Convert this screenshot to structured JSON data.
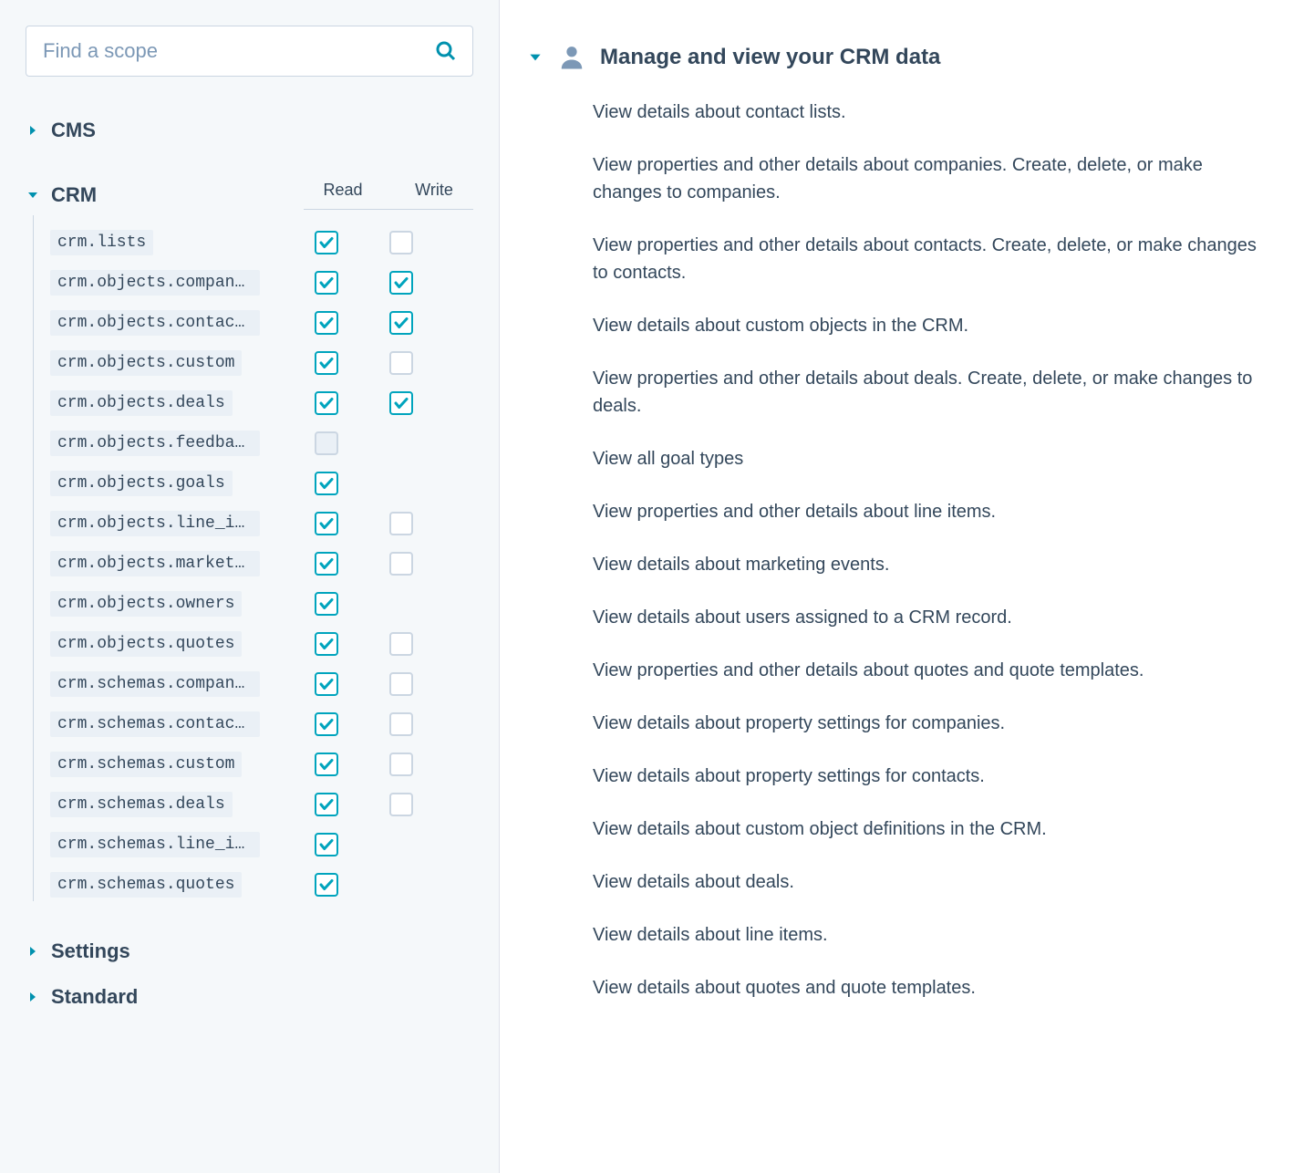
{
  "search": {
    "placeholder": "Find a scope"
  },
  "categories": {
    "cms": {
      "label": "CMS",
      "expanded": false
    },
    "crm": {
      "label": "CRM",
      "expanded": true
    },
    "settings": {
      "label": "Settings",
      "expanded": false
    },
    "standard": {
      "label": "Standard",
      "expanded": false
    }
  },
  "columns": {
    "read": "Read",
    "write": "Write"
  },
  "scopes": [
    {
      "name": "crm.lists",
      "read": true,
      "write": false
    },
    {
      "name": "crm.objects.compani…",
      "read": true,
      "write": true
    },
    {
      "name": "crm.objects.contacts",
      "read": true,
      "write": true
    },
    {
      "name": "crm.objects.custom",
      "read": true,
      "write": false
    },
    {
      "name": "crm.objects.deals",
      "read": true,
      "write": true
    },
    {
      "name": "crm.objects.feedbac…",
      "read": "disabled",
      "write": null
    },
    {
      "name": "crm.objects.goals",
      "read": true,
      "write": null
    },
    {
      "name": "crm.objects.line_it…",
      "read": true,
      "write": false
    },
    {
      "name": "crm.objects.marketi…",
      "read": true,
      "write": false
    },
    {
      "name": "crm.objects.owners",
      "read": true,
      "write": null
    },
    {
      "name": "crm.objects.quotes",
      "read": true,
      "write": false
    },
    {
      "name": "crm.schemas.compani…",
      "read": true,
      "write": false
    },
    {
      "name": "crm.schemas.contacts",
      "read": true,
      "write": false
    },
    {
      "name": "crm.schemas.custom",
      "read": true,
      "write": false
    },
    {
      "name": "crm.schemas.deals",
      "read": true,
      "write": false
    },
    {
      "name": "crm.schemas.line_it…",
      "read": true,
      "write": null
    },
    {
      "name": "crm.schemas.quotes",
      "read": true,
      "write": null
    }
  ],
  "detail": {
    "title": "Manage and view your CRM data",
    "descriptions": [
      "View details about contact lists.",
      "View properties and other details about companies. Create, delete, or make changes to companies.",
      "View properties and other details about contacts. Create, delete, or make changes to contacts.",
      "View details about custom objects in the CRM.",
      "View properties and other details about deals. Create, delete, or make changes to deals.",
      "View all goal types",
      "View properties and other details about line items.",
      "View details about marketing events.",
      "View details about users assigned to a CRM record.",
      "View properties and other details about quotes and quote templates.",
      "View details about property settings for companies.",
      "View details about property settings for contacts.",
      "View details about custom object definitions in the CRM.",
      "View details about deals.",
      "View details about line items.",
      "View details about quotes and quote templates."
    ]
  }
}
